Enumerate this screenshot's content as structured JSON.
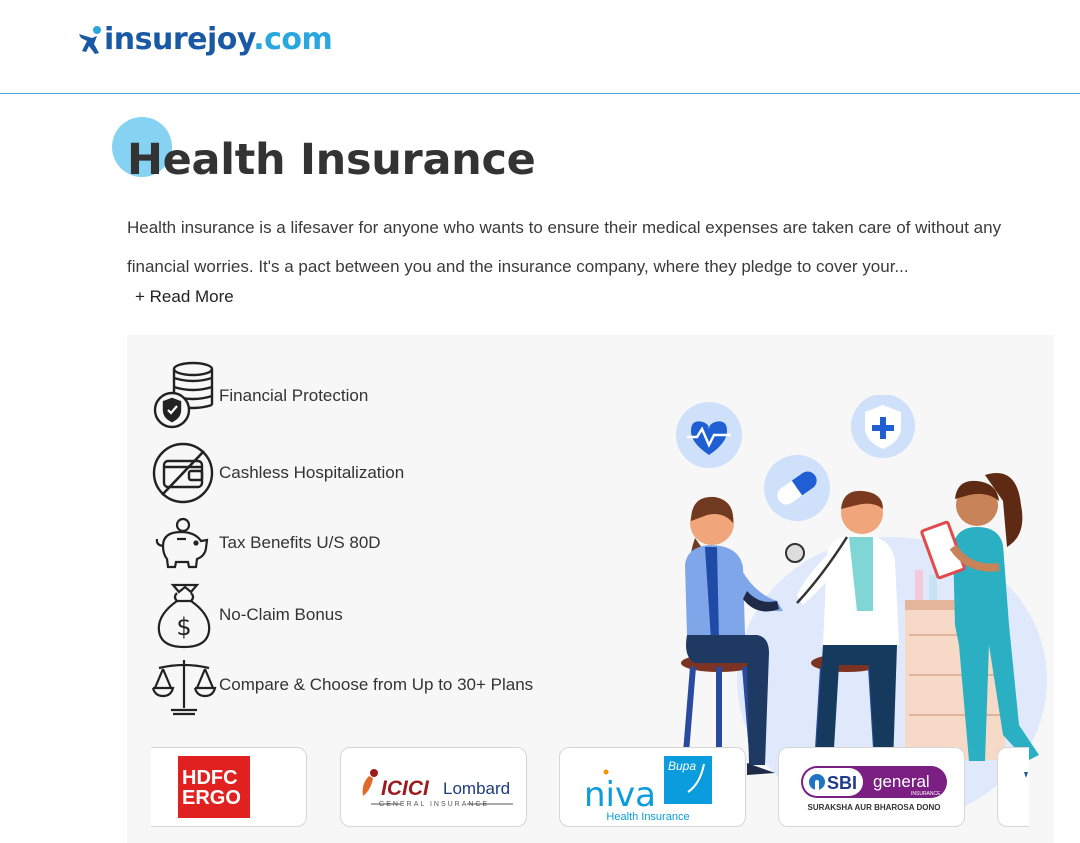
{
  "header": {
    "logo": {
      "brand": "insurejoy",
      "tld": ".com"
    }
  },
  "hero": {
    "title": "Health Insurance",
    "description": "Health insurance is a lifesaver for anyone who wants to ensure their medical expenses are taken care of without any financial worries. It's a pact between you and the insurance company, where they pledge to cover your...",
    "read_more": "+ Read More"
  },
  "features": [
    {
      "icon": "coins-shield-icon",
      "label": "Financial Protection"
    },
    {
      "icon": "no-wallet-icon",
      "label": "Cashless Hospitalization"
    },
    {
      "icon": "piggy-bank-icon",
      "label": "Tax Benefits U/S 80D"
    },
    {
      "icon": "money-bag-icon",
      "label": "No-Claim Bonus"
    },
    {
      "icon": "balance-scale-icon",
      "label": "Compare & Choose from Up to 30+ Plans"
    }
  ],
  "insurers": [
    {
      "name": "HDFC ERGO",
      "line1": "HDFC",
      "line2": "ERGO",
      "color": "#e1211f"
    },
    {
      "name": "ICICI Lombard",
      "brand": "ICICI",
      "product": "Lombard",
      "tagline": "GENERAL INSURANCE",
      "color": "#9b1c1f"
    },
    {
      "name": "niva Bupa",
      "brand": "niva",
      "partner": "Bupa",
      "tagline": "Health Insurance",
      "color": "#0a9cdc"
    },
    {
      "name": "SBI general",
      "brand": "SBI",
      "product": "general",
      "insurance": "INSURANCE",
      "tagline": "SURAKSHA AUR BHAROSA DONO",
      "color": "#7b2082"
    }
  ],
  "colors": {
    "accent": "#29a8e0",
    "brand": "#1a5aa5",
    "title_dot": "#86d2f2",
    "panel_bg": "#f7f7f7"
  }
}
